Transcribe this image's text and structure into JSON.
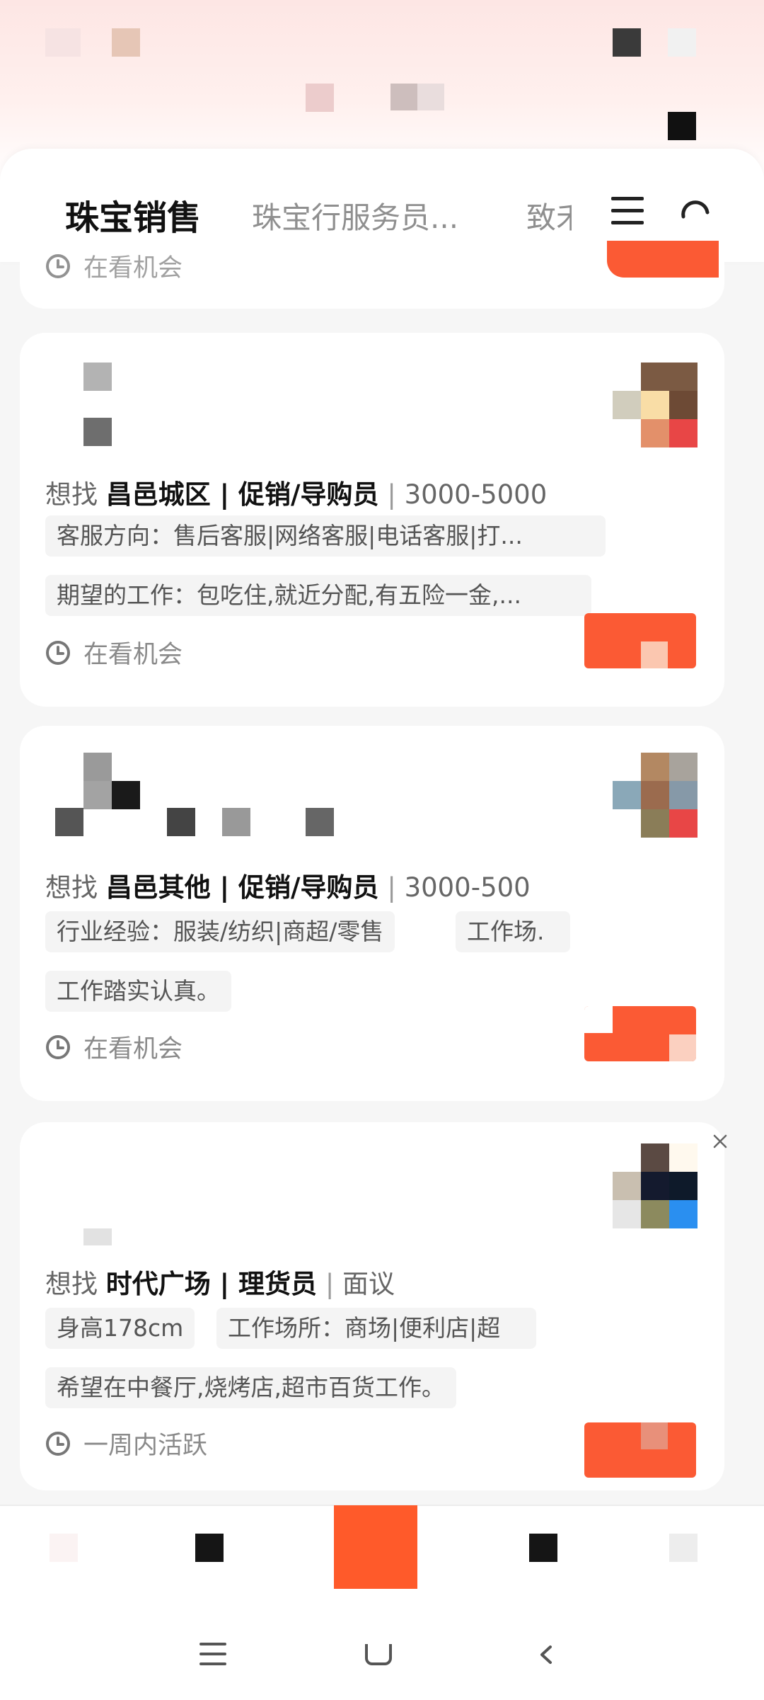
{
  "tabs": [
    {
      "label": "珠宝销售"
    },
    {
      "label": "珠宝行服务员..."
    },
    {
      "label": "致禾"
    }
  ],
  "colors": {
    "accent": "#fb5a34",
    "active_tab": "#111111",
    "inactive_tab": "#8f8f8f"
  },
  "icons": {
    "menu": "menu-icon",
    "refresh": "refresh-icon",
    "clock": "clock-icon",
    "close": "close-icon"
  },
  "prev_card": {
    "status": "在看机会"
  },
  "cards": [
    {
      "prefix": "想找",
      "location": "昌邑城区",
      "position": "促销/导购员",
      "salary": "3000-5000",
      "tags": [
        {
          "text": "客服方向：售后客服|网络客服|电话客服|打..."
        },
        {
          "text": "期望的工作：包吃住,就近分配,有五险一金,..."
        }
      ],
      "status": "在看机会"
    },
    {
      "prefix": "想找",
      "location": "昌邑其他",
      "position": "促销/导购员",
      "salary": "3000-500",
      "tags": [
        {
          "text": "行业经验：服装/纺织|商超/零售"
        },
        {
          "text": "工作场."
        },
        {
          "text": "工作踏实认真。"
        }
      ],
      "status": "在看机会"
    },
    {
      "prefix": "想找",
      "location": "时代广场",
      "position": "理货员",
      "salary": "面议",
      "tags": [
        {
          "text": "身高178cm"
        },
        {
          "text": "工作场所：商场|便利店|超"
        },
        {
          "text": "希望在中餐厅,烧烤店,超市百货工作。"
        }
      ],
      "status": "一周内活跃"
    }
  ],
  "system_nav": {
    "menu": "menu-icon",
    "home": "home-icon",
    "back": "back-icon"
  }
}
